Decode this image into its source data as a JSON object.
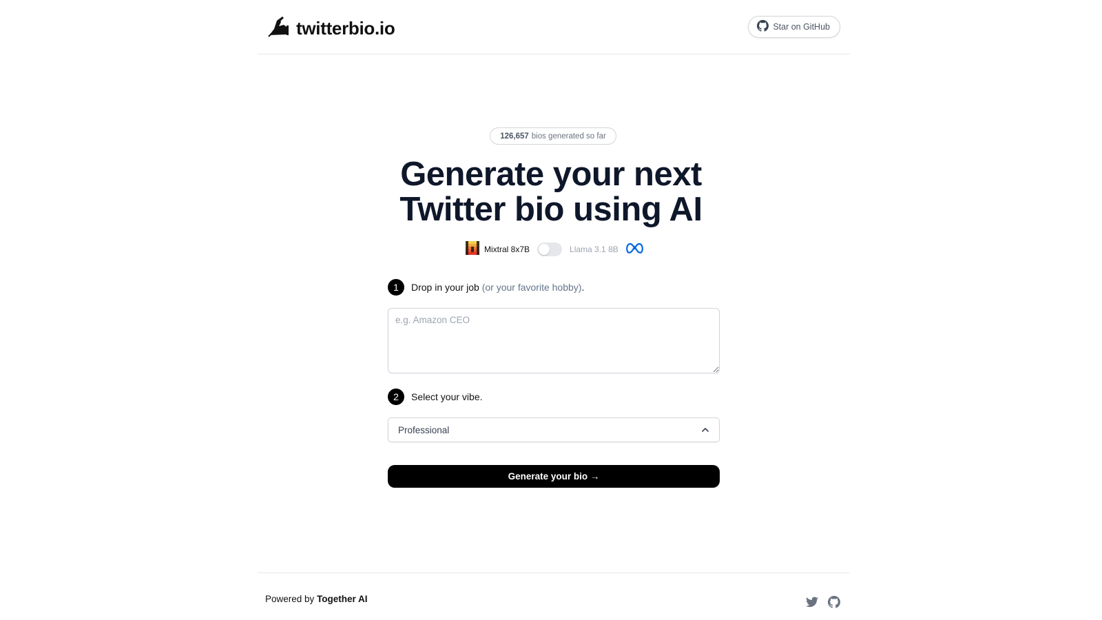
{
  "header": {
    "logo_text": "twitterbio.io",
    "github_label": "Star on GitHub"
  },
  "counter": {
    "count": "126,657",
    "suffix": "bios generated so far"
  },
  "hero": {
    "line1": "Generate your next",
    "line2": "Twitter bio using AI"
  },
  "model_toggle": {
    "left_model": "Mixtral 8x7B",
    "right_model": "Llama 3.1 8B",
    "selected": "Mixtral 8x7B"
  },
  "form": {
    "step1": {
      "number": "1",
      "label": "Drop in your job",
      "hint": "(or your favorite hobby)",
      "punct": "."
    },
    "job_placeholder": "e.g. Amazon CEO",
    "job_value": "",
    "step2": {
      "number": "2",
      "label": "Select your vibe."
    },
    "vibe_selected": "Professional",
    "generate_label": "Generate your bio →"
  },
  "footer": {
    "powered_prefix": "Powered by",
    "powered_brand": "Together AI"
  },
  "colors": {
    "primary": "#000000",
    "headline": "#0f172a",
    "muted": "#64748b",
    "border": "#d1d5db",
    "meta_blue": "#0668E1",
    "mistral_orange": "#F7A21B"
  },
  "icons": [
    "writing-hand-icon",
    "github-icon",
    "mistral-icon",
    "meta-icon",
    "chevron-up-icon",
    "twitter-icon"
  ]
}
